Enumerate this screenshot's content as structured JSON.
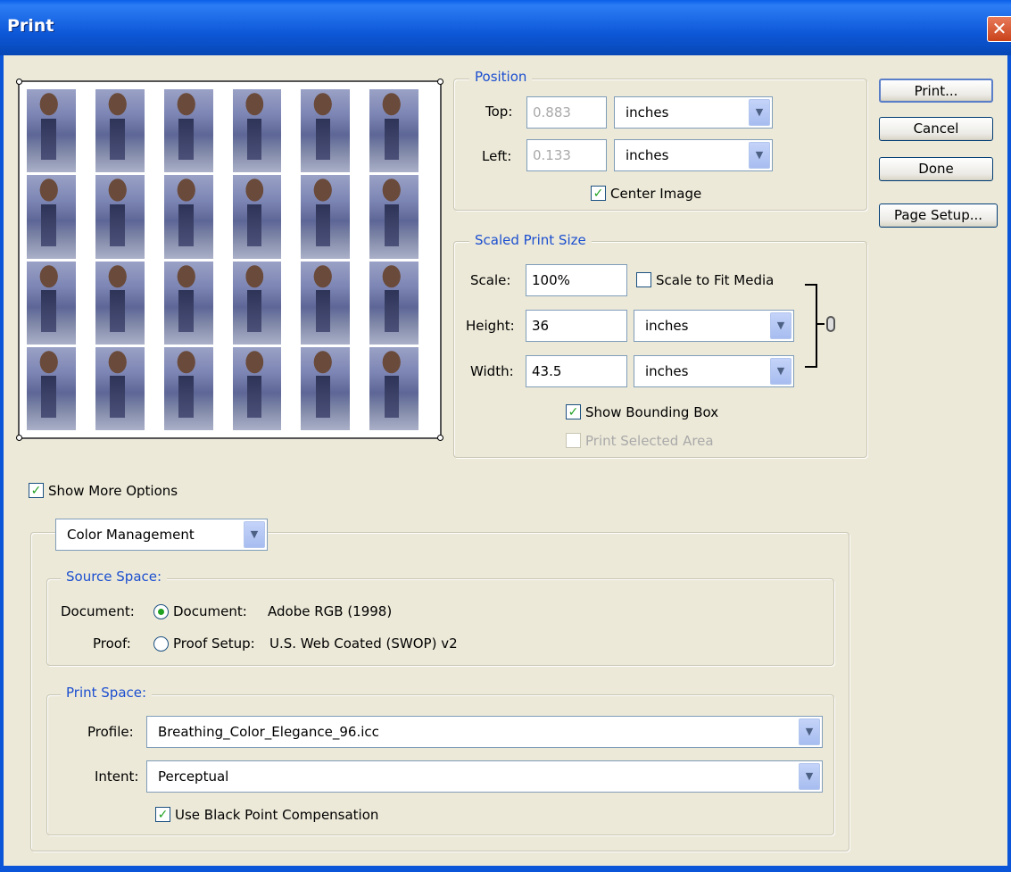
{
  "window": {
    "title": "Print",
    "close_glyph": "✕"
  },
  "buttons": {
    "print": "Print...",
    "cancel": "Cancel",
    "done": "Done",
    "page_setup": "Page Setup..."
  },
  "position": {
    "label": "Position",
    "top_label": "Top:",
    "top_value": "0.883",
    "top_unit": "inches",
    "left_label": "Left:",
    "left_value": "0.133",
    "left_unit": "inches",
    "center_image_label": "Center Image",
    "center_image_checked": true
  },
  "scaled_print_size": {
    "label": "Scaled Print Size",
    "scale_label": "Scale:",
    "scale_value": "100%",
    "scale_to_fit_label": "Scale to Fit Media",
    "scale_to_fit_checked": false,
    "height_label": "Height:",
    "height_value": "36",
    "height_unit": "inches",
    "width_label": "Width:",
    "width_value": "43.5",
    "width_unit": "inches",
    "show_bounding_box_label": "Show Bounding Box",
    "show_bounding_box_checked": true,
    "print_selected_area_label": "Print Selected Area",
    "print_selected_area_checked": false
  },
  "more_options": {
    "show_more_options_label": "Show More Options",
    "show_more_options_checked": true,
    "section_select": "Color Management"
  },
  "source_space": {
    "label": "Source Space:",
    "document_label": "Document:",
    "document_option": "Document:",
    "document_profile": "Adobe RGB (1998)",
    "proof_label": "Proof:",
    "proof_option": "Proof Setup:",
    "proof_profile": "U.S. Web Coated (SWOP) v2",
    "selected": "document"
  },
  "print_space": {
    "label": "Print Space:",
    "profile_label": "Profile:",
    "profile_value": "Breathing_Color_Elegance_96.icc",
    "intent_label": "Intent:",
    "intent_value": "Perceptual",
    "black_point_label": "Use Black Point Compensation",
    "black_point_checked": true
  },
  "icons": {
    "check": "✓",
    "dropdown": "▼",
    "chain": "🔗"
  }
}
